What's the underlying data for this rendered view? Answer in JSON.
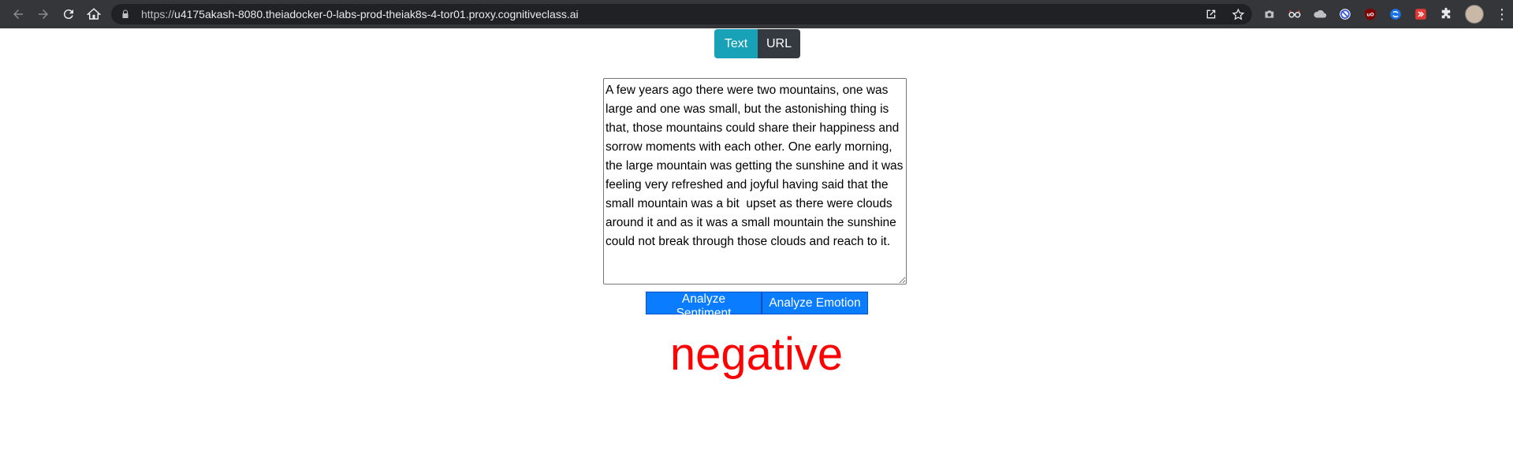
{
  "browser": {
    "url_scheme": "https://",
    "url_host": "u4175akash-8080.theiadocker-0-labs-prod-theiak8s-4-tor01.proxy.cognitiveclass.ai",
    "nav_icons": [
      "back-icon",
      "forward-icon",
      "reload-icon",
      "home-icon"
    ],
    "omnibox_icons": [
      "share-icon",
      "bookmark-star-icon"
    ],
    "extensions": [
      {
        "name": "camera-extension-icon",
        "color": "#5f6368",
        "glyph": "◉"
      },
      {
        "name": "glasses-extension-icon",
        "color": "#35363a",
        "glyph": "∞"
      },
      {
        "name": "cloud-extension-icon",
        "color": "#35363a",
        "glyph": "☁"
      },
      {
        "name": "block-extension-icon",
        "color": "#3b5bdb",
        "glyph": "⊘"
      },
      {
        "name": "ublock-extension-icon",
        "color": "#800000",
        "glyph": "uO"
      },
      {
        "name": "blue-circle-extension-icon",
        "color": "#1a73e8",
        "glyph": "S"
      },
      {
        "name": "red-extension-icon",
        "color": "#e53935",
        "glyph": "▶"
      },
      {
        "name": "puzzle-extensions-icon",
        "color": "#35363a",
        "glyph": "✚"
      }
    ]
  },
  "mode_toggle": {
    "text_label": "Text",
    "url_label": "URL"
  },
  "input": {
    "value": "A few years ago there were two mountains, one was large and one was small, but the astonishing thing is that, those mountains could share their happiness and sorrow moments with each other. One early morning, the large mountain was getting the sunshine and it was feeling very refreshed and joyful having said that the small mountain was a bit  upset as there were clouds around it and as it was a small mountain the sunshine could not break through those clouds and reach to it."
  },
  "actions": {
    "sentiment_label": "Analyze Sentiment",
    "emotion_label": "Analyze Emotion"
  },
  "result": {
    "text": "negative",
    "color": "#ff0000"
  }
}
